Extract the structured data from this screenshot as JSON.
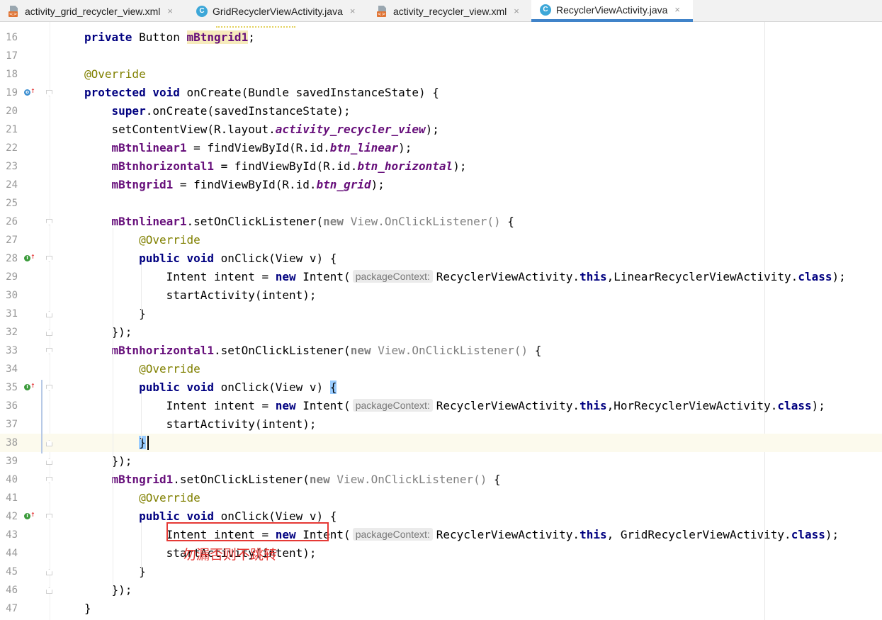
{
  "tabs": [
    {
      "label": "activity_grid_recycler_view.xml",
      "icon": "xml-file-icon",
      "active": false
    },
    {
      "label": "GridRecyclerViewActivity.java",
      "icon": "java-class-icon",
      "active": false
    },
    {
      "label": "activity_recycler_view.xml",
      "icon": "xml-file-icon",
      "active": false
    },
    {
      "label": "RecyclerViewActivity.java",
      "icon": "java-class-icon",
      "active": true
    }
  ],
  "tab_close_glyph": "×",
  "class_icon_letter": "C",
  "xml_icon_text": "<>",
  "gutter": {
    "line_numbers": [
      "16",
      "17",
      "18",
      "19",
      "20",
      "21",
      "22",
      "23",
      "24",
      "25",
      "26",
      "27",
      "28",
      "29",
      "30",
      "31",
      "32",
      "33",
      "34",
      "35",
      "36",
      "37",
      "38",
      "39",
      "40",
      "41",
      "42",
      "43",
      "44",
      "45",
      "46",
      "47"
    ],
    "marker_icons": {
      "19": "override-method-icon",
      "28": "implement-method-icon",
      "35": "implement-method-icon",
      "42": "implement-method-icon"
    }
  },
  "code_lines": [
    [
      {
        "t": "private ",
        "c": "kw"
      },
      {
        "t": "Button "
      },
      {
        "t": "mBtngrid1",
        "c": "fld hl-field"
      },
      {
        "t": ";"
      }
    ],
    [],
    [
      {
        "t": "@Override",
        "c": "ann"
      }
    ],
    [
      {
        "t": "protected ",
        "c": "kw"
      },
      {
        "t": "void ",
        "c": "kw"
      },
      {
        "t": "onCreate(Bundle savedInstanceState) {"
      }
    ],
    [
      {
        "t": "    "
      },
      {
        "t": "super",
        "c": "kw"
      },
      {
        "t": ".onCreate(savedInstanceState);"
      }
    ],
    [
      {
        "t": "    setContentView(R.layout."
      },
      {
        "t": "activity_recycler_view",
        "c": "fldi"
      },
      {
        "t": ");"
      }
    ],
    [
      {
        "t": "    "
      },
      {
        "t": "mBtnlinear1",
        "c": "fld"
      },
      {
        "t": " = findViewById(R.id."
      },
      {
        "t": "btn_linear",
        "c": "fldi"
      },
      {
        "t": ");"
      }
    ],
    [
      {
        "t": "    "
      },
      {
        "t": "mBtnhorizontal1",
        "c": "fld"
      },
      {
        "t": " = findViewById(R.id."
      },
      {
        "t": "btn_horizontal",
        "c": "fldi"
      },
      {
        "t": ");"
      }
    ],
    [
      {
        "t": "    "
      },
      {
        "t": "mBtngrid1",
        "c": "fld"
      },
      {
        "t": " = findViewById(R.id."
      },
      {
        "t": "btn_grid",
        "c": "fldi"
      },
      {
        "t": ");"
      }
    ],
    [],
    [
      {
        "t": "    "
      },
      {
        "t": "mBtnlinear1",
        "c": "fld"
      },
      {
        "t": ".setOnClickListener("
      },
      {
        "t": "new ",
        "c": "kw gray"
      },
      {
        "t": "View.OnClickListener() ",
        "c": "gray"
      },
      {
        "t": "{"
      }
    ],
    [
      {
        "t": "        "
      },
      {
        "t": "@Override",
        "c": "ann"
      }
    ],
    [
      {
        "t": "        "
      },
      {
        "t": "public ",
        "c": "kw"
      },
      {
        "t": "void ",
        "c": "kw"
      },
      {
        "t": "onClick(View v) {"
      }
    ],
    [
      {
        "t": "            Intent intent = "
      },
      {
        "t": "new ",
        "c": "kw"
      },
      {
        "t": "Intent("
      },
      {
        "hint": "packageContext:"
      },
      {
        "t": "RecyclerViewActivity."
      },
      {
        "t": "this",
        "c": "kw"
      },
      {
        "t": ",LinearRecyclerViewActivity."
      },
      {
        "t": "class",
        "c": "kw"
      },
      {
        "t": ");"
      }
    ],
    [
      {
        "t": "            startActivity(intent);"
      }
    ],
    [
      {
        "t": "        }"
      }
    ],
    [
      {
        "t": "    });"
      }
    ],
    [
      {
        "t": "    "
      },
      {
        "t": "mBtnhorizontal1",
        "c": "fld"
      },
      {
        "t": ".setOnClickListener("
      },
      {
        "t": "new ",
        "c": "kw gray"
      },
      {
        "t": "View.OnClickListener() ",
        "c": "gray"
      },
      {
        "t": "{"
      }
    ],
    [
      {
        "t": "        "
      },
      {
        "t": "@Override",
        "c": "ann"
      }
    ],
    [
      {
        "t": "        "
      },
      {
        "t": "public ",
        "c": "kw"
      },
      {
        "t": "void ",
        "c": "kw"
      },
      {
        "t": "onClick(View v) "
      },
      {
        "t": "{",
        "c": "brace-match"
      }
    ],
    [
      {
        "t": "            Intent intent = "
      },
      {
        "t": "new ",
        "c": "kw"
      },
      {
        "t": "Intent("
      },
      {
        "hint": "packageContext:"
      },
      {
        "t": "RecyclerViewActivity."
      },
      {
        "t": "this",
        "c": "kw"
      },
      {
        "t": ",HorRecyclerViewActivity."
      },
      {
        "t": "class",
        "c": "kw"
      },
      {
        "t": ");"
      }
    ],
    [
      {
        "t": "            startActivity(intent);"
      }
    ],
    [
      {
        "t": "        "
      },
      {
        "t": "}",
        "c": "brace-match"
      }
    ],
    [
      {
        "t": "    });"
      }
    ],
    [
      {
        "t": "    "
      },
      {
        "t": "mBtngrid1",
        "c": "fld"
      },
      {
        "t": ".setOnClickListener("
      },
      {
        "t": "new ",
        "c": "kw gray"
      },
      {
        "t": "View.OnClickListener() ",
        "c": "gray"
      },
      {
        "t": "{"
      }
    ],
    [
      {
        "t": "        "
      },
      {
        "t": "@Override",
        "c": "ann"
      }
    ],
    [
      {
        "t": "        "
      },
      {
        "t": "public ",
        "c": "kw"
      },
      {
        "t": "void ",
        "c": "kw"
      },
      {
        "t": "onClick(View v) {"
      }
    ],
    [
      {
        "t": "            Intent intent = "
      },
      {
        "t": "new ",
        "c": "kw"
      },
      {
        "t": "Intent("
      },
      {
        "hint": "packageContext:"
      },
      {
        "t": "RecyclerViewActivity."
      },
      {
        "t": "this",
        "c": "kw"
      },
      {
        "t": ", GridRecyclerViewActivity."
      },
      {
        "t": "class",
        "c": "kw"
      },
      {
        "t": ");"
      }
    ],
    [
      {
        "t": "            startActivity(intent);"
      }
    ],
    [
      {
        "t": "        }"
      }
    ],
    [
      {
        "t": "    });"
      }
    ],
    [
      {
        "t": "}"
      }
    ]
  ],
  "current_line": "38",
  "annotation": {
    "note": "勿漏否则不跳转"
  }
}
